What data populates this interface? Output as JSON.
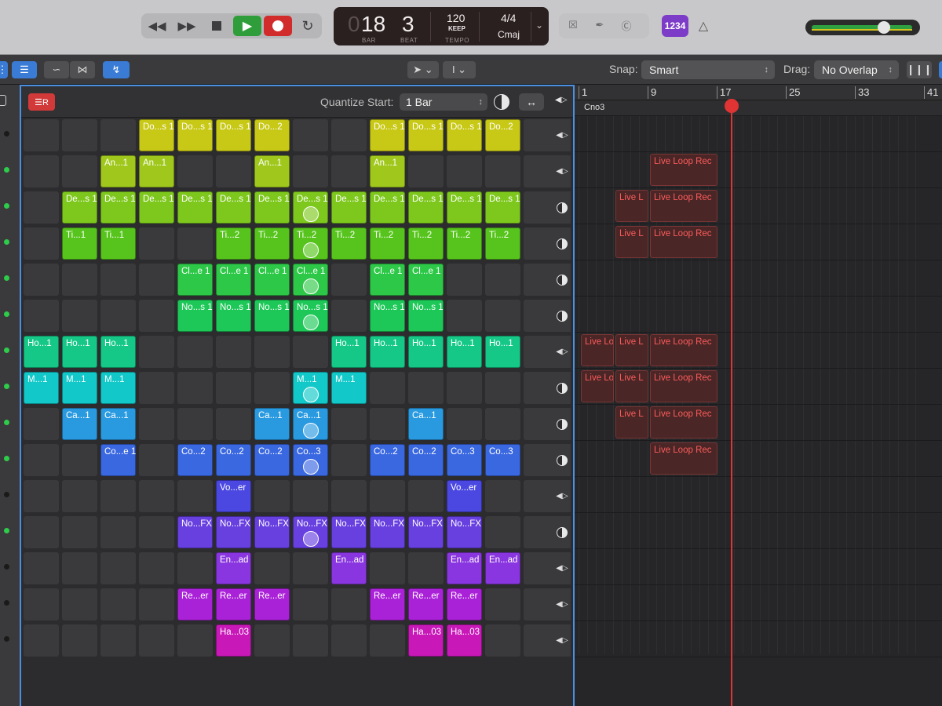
{
  "lcd": {
    "bar": "18",
    "bar_caption": "BAR",
    "beat": "3",
    "beat_caption": "BEAT",
    "tempo": "120",
    "tempo_mode": "KEEP",
    "tempo_caption": "TEMPO",
    "signature": "4/4",
    "key": "Cmaj"
  },
  "transport": {
    "rewind_icon": "rewind-icon",
    "forward_icon": "fast-forward-icon",
    "stop_icon": "stop-icon",
    "play_icon": "play-icon",
    "record_icon": "record-icon",
    "cycle_icon": "cycle-icon"
  },
  "count_in_label": "1234",
  "toolbar": {
    "snap_label": "Snap:",
    "snap_value": "Smart",
    "drag_label": "Drag:",
    "drag_value": "No Overlap"
  },
  "grid": {
    "quantize_label": "Quantize Start:",
    "quantize_value": "1 Bar"
  },
  "ruler": {
    "bars": [
      "1",
      "9",
      "17",
      "25",
      "33",
      "41"
    ],
    "marker": "Cno3"
  },
  "colors": {
    "row_colors": [
      "#c8c816",
      "#a0c81c",
      "#7ec81e",
      "#56c41c",
      "#2ec848",
      "#1ec858",
      "#16c888",
      "#12c8c8",
      "#2a9ae0",
      "#3a68e0",
      "#4a48e0",
      "#6840e0",
      "#8a36e0",
      "#aa22d8",
      "#c818b8"
    ],
    "active_dot": "#2ecc4a",
    "inactive_dot": "#1a1a1a",
    "region_text": "#ff5b5b"
  },
  "rows": [
    {
      "active": false,
      "trigger": "play-stop",
      "cells": [
        null,
        null,
        null,
        "Do...s 1",
        "Do...s 1",
        "Do...s 1",
        "Do...2",
        null,
        null,
        "Do...s 1",
        "Do...s 1",
        "Do...s 1",
        "Do...2",
        null
      ],
      "progress": []
    },
    {
      "active": true,
      "trigger": "play-stop",
      "cells": [
        null,
        null,
        "An...1",
        "An...1",
        null,
        null,
        "An...1",
        null,
        null,
        "An...1",
        null,
        null,
        null,
        null
      ],
      "progress": []
    },
    {
      "active": true,
      "trigger": "ring",
      "cells": [
        null,
        "De...s 1",
        "De...s 1",
        "De...s 1",
        "De...s 1",
        "De...s 1",
        "De...s 1",
        "De...s 1",
        "De...s 1",
        "De...s 1",
        "De...s 1",
        "De...s 1",
        "De...s 1",
        null
      ],
      "progress": [
        7
      ]
    },
    {
      "active": true,
      "trigger": "ring",
      "cells": [
        null,
        "Ti...1",
        "Ti...1",
        null,
        null,
        "Ti...2",
        "Ti...2",
        "Ti...2",
        "Ti...2",
        "Ti...2",
        "Ti...2",
        "Ti...2",
        "Ti...2",
        null
      ],
      "progress": [
        7
      ]
    },
    {
      "active": true,
      "trigger": "ring",
      "cells": [
        null,
        null,
        null,
        null,
        "Cl...e 1",
        "Cl...e 1",
        "Cl...e 1",
        "Cl...e 1",
        null,
        "Cl...e 1",
        "Cl...e 1",
        null,
        null,
        null
      ],
      "progress": [
        7
      ]
    },
    {
      "active": true,
      "trigger": "ring",
      "cells": [
        null,
        null,
        null,
        null,
        "No...s 1",
        "No...s 1",
        "No...s 1",
        "No...s 1",
        null,
        "No...s 1",
        "No...s 1",
        null,
        null,
        null
      ],
      "progress": [
        7
      ]
    },
    {
      "active": true,
      "trigger": "play-stop",
      "cells": [
        "Ho...1",
        "Ho...1",
        "Ho...1",
        null,
        null,
        null,
        null,
        null,
        "Ho...1",
        "Ho...1",
        "Ho...1",
        "Ho...1",
        "Ho...1",
        null
      ],
      "progress": []
    },
    {
      "active": true,
      "trigger": "ring",
      "cells": [
        "M...1",
        "M...1",
        "M...1",
        null,
        null,
        null,
        null,
        "M...1",
        "M...1",
        null,
        null,
        null,
        null,
        null
      ],
      "progress": [
        7
      ]
    },
    {
      "active": true,
      "trigger": "ring",
      "cells": [
        null,
        "Ca...1",
        "Ca...1",
        null,
        null,
        null,
        "Ca...1",
        "Ca...1",
        null,
        null,
        "Ca...1",
        null,
        null,
        null
      ],
      "progress": [
        7
      ]
    },
    {
      "active": true,
      "trigger": "ring",
      "cells": [
        null,
        null,
        "Co...e 1",
        null,
        "Co...2",
        "Co...2",
        "Co...2",
        "Co...3",
        null,
        "Co...2",
        "Co...2",
        "Co...3",
        "Co...3",
        null
      ],
      "progress": [
        7
      ]
    },
    {
      "active": false,
      "trigger": "play-stop",
      "cells": [
        null,
        null,
        null,
        null,
        null,
        "Vo...er",
        null,
        null,
        null,
        null,
        null,
        "Vo...er",
        null,
        null
      ],
      "progress": []
    },
    {
      "active": true,
      "trigger": "ring",
      "cells": [
        null,
        null,
        null,
        null,
        "No...FX",
        "No...FX",
        "No...FX",
        "No...FX",
        "No...FX",
        "No...FX",
        "No...FX",
        "No...FX",
        null,
        null
      ],
      "progress": [
        7
      ]
    },
    {
      "active": false,
      "trigger": "play-stop",
      "cells": [
        null,
        null,
        null,
        null,
        null,
        "En...ad",
        null,
        null,
        "En...ad",
        null,
        null,
        "En...ad",
        "En...ad",
        null
      ],
      "progress": []
    },
    {
      "active": false,
      "trigger": "play-stop",
      "cells": [
        null,
        null,
        null,
        null,
        "Re...er",
        "Re...er",
        "Re...er",
        null,
        null,
        "Re...er",
        "Re...er",
        "Re...er",
        null,
        null
      ],
      "progress": []
    },
    {
      "active": false,
      "trigger": "play-stop",
      "cells": [
        null,
        null,
        null,
        null,
        null,
        "Ha...03",
        null,
        null,
        null,
        null,
        "Ha...03",
        "Ha...03",
        null,
        null
      ],
      "progress": []
    }
  ],
  "regions": [
    {
      "row": 1,
      "label": "Live Loop Rec",
      "start": 9,
      "end": 17
    },
    {
      "row": 2,
      "label": "Live L",
      "start": 5,
      "end": 9
    },
    {
      "row": 2,
      "label": "Live Loop Rec",
      "start": 9,
      "end": 17
    },
    {
      "row": 3,
      "label": "Live L",
      "start": 5,
      "end": 9
    },
    {
      "row": 3,
      "label": "Live Loop Rec",
      "start": 9,
      "end": 17
    },
    {
      "row": 6,
      "label": "Live Loo",
      "start": 1,
      "end": 5
    },
    {
      "row": 6,
      "label": "Live L",
      "start": 5,
      "end": 9
    },
    {
      "row": 6,
      "label": "Live Loop Rec",
      "start": 9,
      "end": 17
    },
    {
      "row": 7,
      "label": "Live Loo",
      "start": 1,
      "end": 5
    },
    {
      "row": 7,
      "label": "Live L",
      "start": 5,
      "end": 9
    },
    {
      "row": 7,
      "label": "Live Loop Rec",
      "start": 9,
      "end": 17
    },
    {
      "row": 8,
      "label": "Live L",
      "start": 5,
      "end": 9
    },
    {
      "row": 8,
      "label": "Live Loop Rec",
      "start": 9,
      "end": 17
    },
    {
      "row": 9,
      "label": "Live Loop Rec",
      "start": 9,
      "end": 17
    }
  ]
}
